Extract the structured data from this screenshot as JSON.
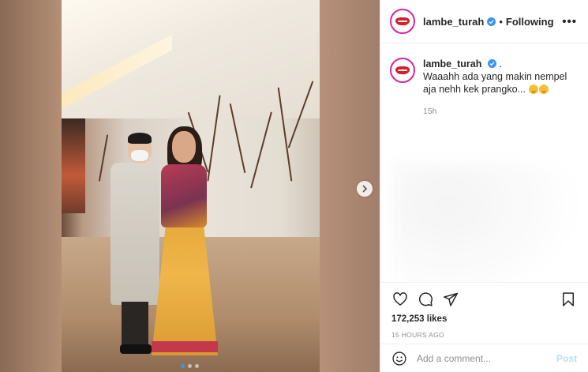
{
  "header": {
    "username": "lambe_turah",
    "separator": "•",
    "follow_status": "Following",
    "more_label": "•••",
    "verified_icon": "verified-badge-icon",
    "avatar_icon": "red-lips-logo"
  },
  "caption": {
    "username": "lambe_turah",
    "suffix": ".",
    "text": "Waaahh ada yang makin nempel aja nehh kek prangko...",
    "emojis": [
      "grimacing-face",
      "grimacing-face"
    ],
    "time_ago": "15h"
  },
  "actions": {
    "like_icon": "heart-icon",
    "comment_icon": "comment-icon",
    "share_icon": "share-icon",
    "save_icon": "bookmark-icon",
    "likes": "172,253 likes",
    "timestamp": "15 HOURS AGO"
  },
  "comment_box": {
    "emoji_icon": "smiley-icon",
    "placeholder": "Add a comment...",
    "post_label": "Post"
  },
  "carousel": {
    "slide_count": 3,
    "active_slide": 1,
    "next_icon": "chevron-right-icon"
  },
  "colors": {
    "accent": "#3897f0",
    "post_disabled": "#b2dffc",
    "verified": "#3897f0",
    "muted_text": "#8e8e8e"
  }
}
